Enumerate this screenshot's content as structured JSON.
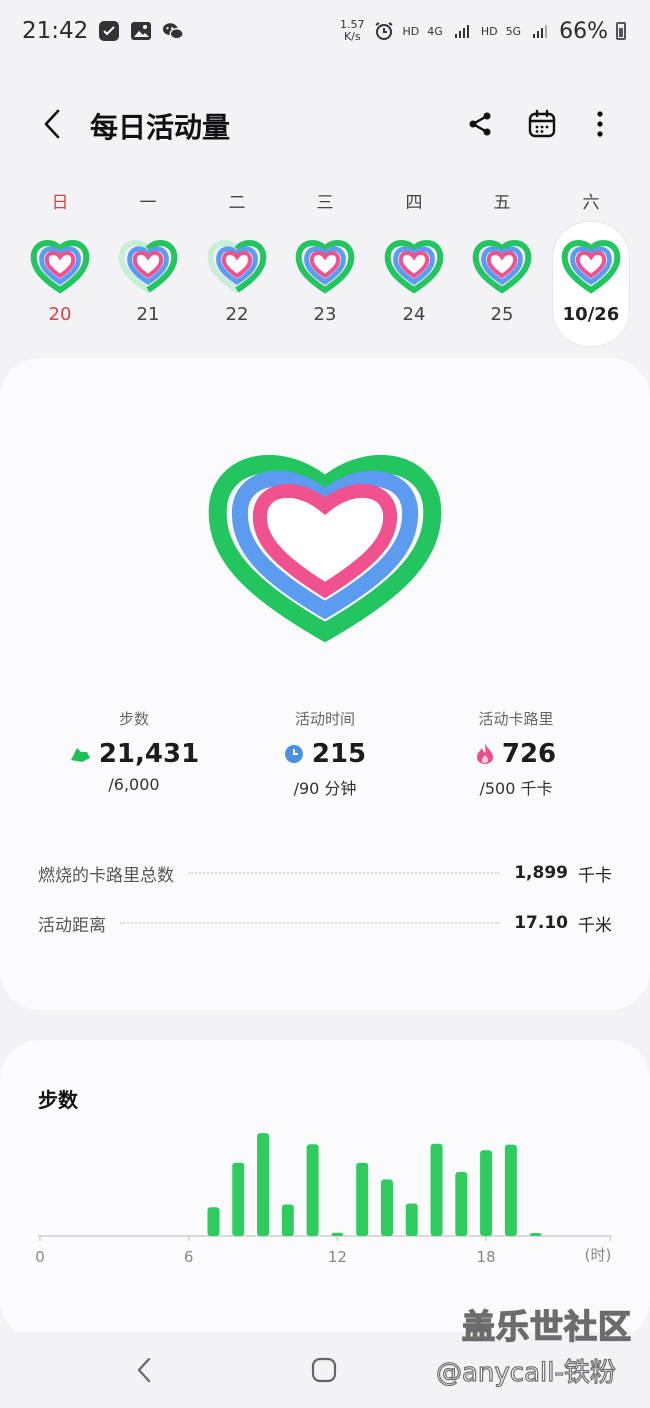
{
  "status_bar": {
    "time": "21:42",
    "net_speed_value": "1.57",
    "net_speed_unit": "K/s",
    "hd1": "HD",
    "net1": "4G",
    "hd2": "HD",
    "net2": "5G",
    "battery": "66%"
  },
  "header": {
    "title": "每日活动量"
  },
  "week": [
    {
      "dow": "日",
      "date": "20",
      "sunday": true,
      "selected": false
    },
    {
      "dow": "一",
      "date": "21",
      "sunday": false,
      "selected": false
    },
    {
      "dow": "二",
      "date": "22",
      "sunday": false,
      "selected": false
    },
    {
      "dow": "三",
      "date": "23",
      "sunday": false,
      "selected": false
    },
    {
      "dow": "四",
      "date": "24",
      "sunday": false,
      "selected": false
    },
    {
      "dow": "五",
      "date": "25",
      "sunday": false,
      "selected": false
    },
    {
      "dow": "六",
      "date": "10/26",
      "sunday": false,
      "selected": true
    }
  ],
  "stats": {
    "steps": {
      "label": "步数",
      "value": "21,431",
      "goal": "/6,000"
    },
    "active_time": {
      "label": "活动时间",
      "value": "215",
      "goal": "/90 分钟"
    },
    "active_calories": {
      "label": "活动卡路里",
      "value": "726",
      "goal": "/500 千卡"
    }
  },
  "details": {
    "total_burned": {
      "label": "燃烧的卡路里总数",
      "value": "1,899",
      "unit": "千卡"
    },
    "distance": {
      "label": "活动距离",
      "value": "17.10",
      "unit": "千米"
    }
  },
  "chart_section": {
    "title": "步数"
  },
  "chart_data": {
    "type": "bar",
    "title": "步数",
    "x_unit": "(时)",
    "x_ticks": [
      "0",
      "6",
      "12",
      "18"
    ],
    "xlim": [
      0,
      23
    ],
    "ylim": [
      0,
      2200
    ],
    "color": "#2ecc5f",
    "hours": [
      7,
      8,
      9,
      10,
      11,
      12,
      13,
      14,
      15,
      16,
      17,
      18,
      19,
      20
    ],
    "values": [
      620,
      1580,
      2220,
      680,
      1980,
      70,
      1580,
      1220,
      700,
      1990,
      1380,
      1850,
      1970,
      60
    ]
  },
  "colors": {
    "ring_green": "#22c55e",
    "ring_blue": "#5b9cf0",
    "ring_pink": "#f0528f",
    "steps_icon": "#1fbf5a",
    "time_icon": "#4a90e2",
    "cal_icon": "#ef4e8c"
  },
  "watermark": {
    "line1": "盖乐世社区",
    "line2": "@anycall-铁粉"
  }
}
